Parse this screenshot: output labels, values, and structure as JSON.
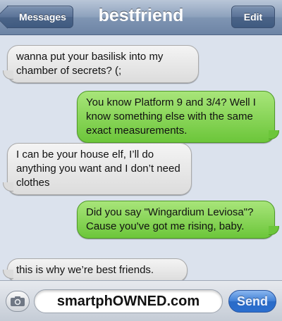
{
  "navbar": {
    "back_label": "Messages",
    "title": "bestfriend",
    "edit_label": "Edit"
  },
  "messages": [
    {
      "direction": "received",
      "text": "wanna put your basilisk into my chamber of secrets? (;"
    },
    {
      "direction": "sent",
      "text": "You know Platform 9 and 3/4? Well I know something else with the same exact measurements."
    },
    {
      "direction": "received",
      "text": "I can be your house elf, I’ll do anything you want and I don’t need clothes"
    },
    {
      "direction": "sent",
      "text": "Did you say \"Wingardium Leviosa\"? Cause you've got me rising, baby."
    },
    {
      "direction": "received",
      "text": "this is why we’re best friends."
    }
  ],
  "composer": {
    "camera_icon": "camera-icon",
    "input_value": "smartphOWNED.com",
    "send_label": "Send"
  },
  "colors": {
    "sent_bubble": "#6cc63a",
    "received_bubble": "#dcdcdc",
    "send_button": "#2b6fcf",
    "navbar": "#7f95b3"
  }
}
